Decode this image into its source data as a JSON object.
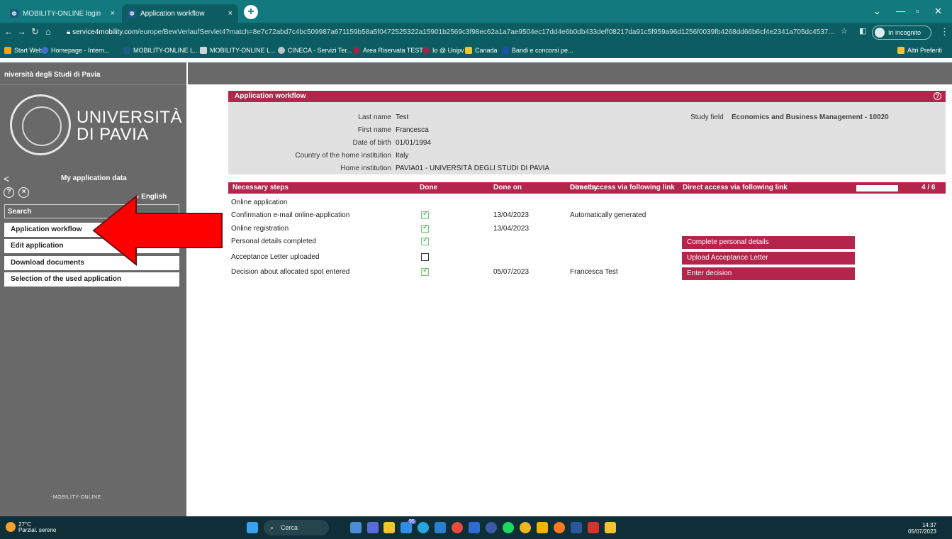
{
  "browser": {
    "tabs": [
      {
        "title": "MOBILITY-ONLINE login",
        "close": "×"
      },
      {
        "title": "Application workflow",
        "close": "×"
      }
    ],
    "new_tab": "+",
    "url_host": "service4mobility.com",
    "url_path": "/europe/BewVerlaufServlet4?match=8e7c72abd7c4bc509987a671159b58a5f0472525322a15901b2569c3f98ec62a1a7ae9504ec17dd4e6b0db433deff08217da91c5f959a96d1256f0039fb4268dd66b6cf4e2341a705dc4537...",
    "url_star": "☆",
    "incognito_label": "In incognito",
    "bookmarks": [
      "Start Web",
      "Homepage - Intern...",
      "MOBILITY-ONLINE L...",
      "MOBILITY-ONLINE L...",
      "CINECA - Servizi Ter...",
      "Area Riservata TEST",
      "Io @ Unipv",
      "Canada",
      "Bandi e concorsi pe..."
    ],
    "other_bookmarks": "Altri Preferiti"
  },
  "sidebar": {
    "university_header": "niversità degli Studi di Pavia",
    "logo_line1": "UNIVERSITÀ",
    "logo_line2": "DI PAVIA",
    "my_application_data": "My application data",
    "back": "<",
    "help": "?",
    "close": "×",
    "language": "English",
    "search_label": "Search",
    "menu": [
      "Application workflow",
      "Edit application",
      "Download documents",
      "Selection of the used application"
    ],
    "footer_logo": "MOBILITY-ONLINE"
  },
  "main": {
    "title": "Application workflow",
    "help": "?",
    "info": {
      "last_name_label": "Last name",
      "last_name": "Test",
      "first_name_label": "First name",
      "first_name": "Francesca",
      "dob_label": "Date of birth",
      "dob": "01/01/1994",
      "country_label": "Country of the home institution",
      "country": "Italy",
      "institution_label": "Home institution",
      "institution": "PAVIA01 - UNIVERSITÀ DEGLI STUDI DI PAVIA",
      "study_field_label": "Study field",
      "study_field": "Economics and Business Management - 10020"
    },
    "steps_header": {
      "steps": "Necessary steps",
      "done": "Done",
      "done_on": "Done on",
      "done_by": "Done by",
      "direct_access": "Direct access via following link",
      "progress_text": "4 / 6"
    },
    "progress": {
      "done": 4,
      "total": 6
    },
    "steps": [
      {
        "name": "Online application",
        "done": null,
        "done_on": "",
        "done_by": "",
        "link": ""
      },
      {
        "name": "Confirmation e-mail online-application",
        "done": true,
        "done_on": "13/04/2023",
        "done_by": "Automatically generated",
        "link": ""
      },
      {
        "name": "Online registration",
        "done": true,
        "done_on": "13/04/2023",
        "done_by": "",
        "link": ""
      },
      {
        "name": "Personal details completed",
        "done": true,
        "done_on": "",
        "done_by": "",
        "link": "Complete personal details"
      },
      {
        "name": "Acceptance Letter uploaded",
        "done": false,
        "done_on": "",
        "done_by": "",
        "link": "Upload Acceptance Letter"
      },
      {
        "name": "Decision about allocated spot entered",
        "done": true,
        "done_on": "05/07/2023",
        "done_by": "Francesca Test",
        "link": "Enter decision"
      }
    ]
  },
  "taskbar": {
    "temp": "27°C",
    "weather": "Parzial. sereno",
    "search": "Cerca",
    "time": "14:37",
    "date": "05/07/2023",
    "badge": "95"
  },
  "colors": {
    "accent": "#b3254b",
    "sidebar": "#696969",
    "chrome": "#127a7f",
    "arrow": "#ff0000"
  }
}
